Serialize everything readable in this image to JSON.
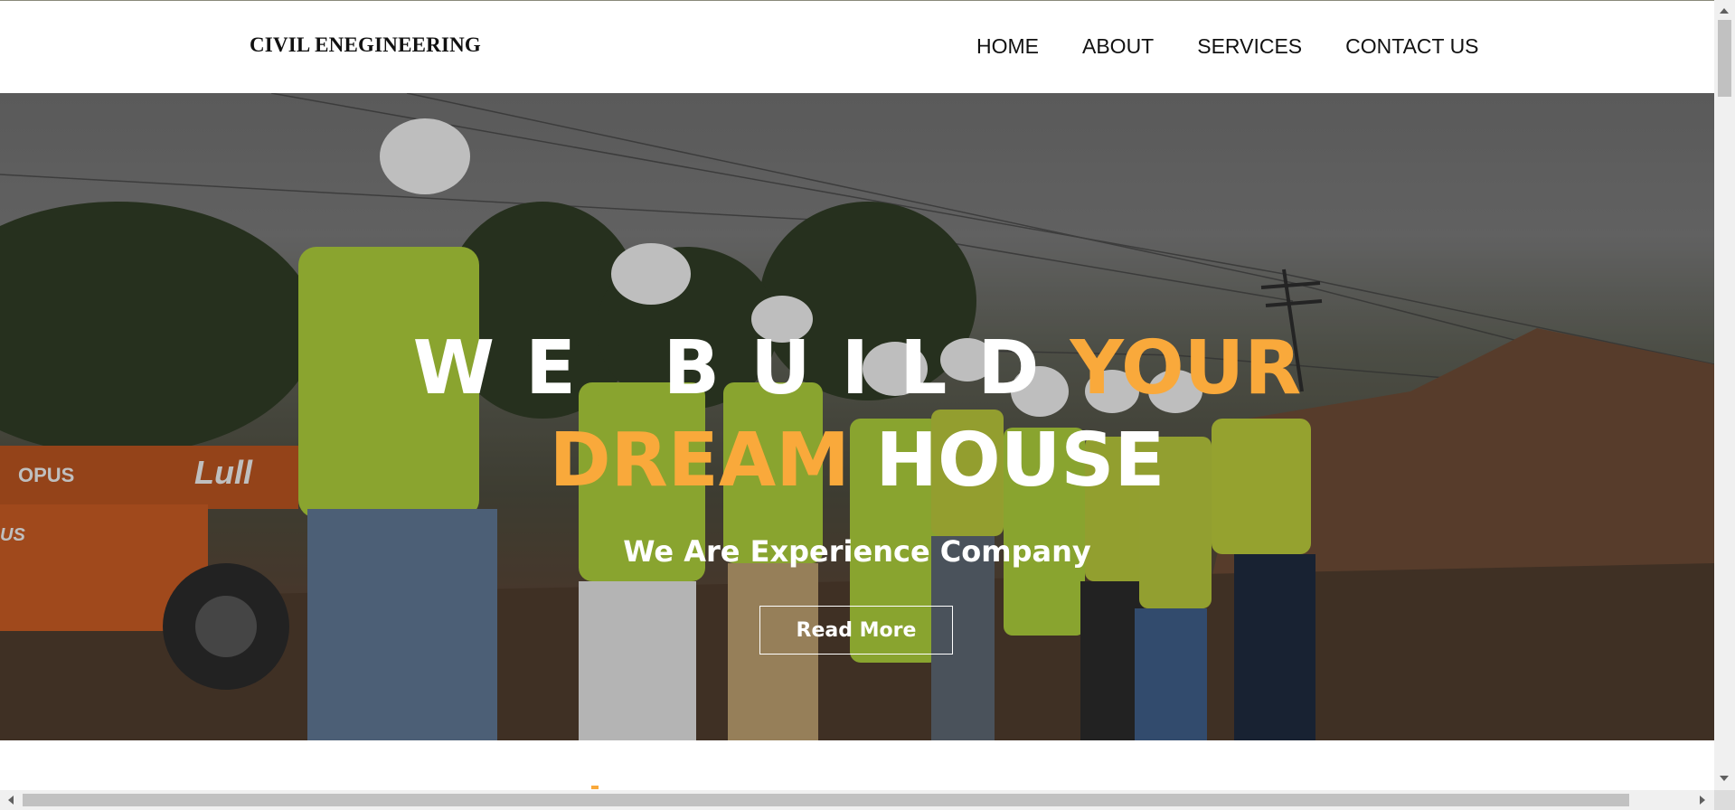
{
  "header": {
    "logo": "CIVIL ENEGINEERING",
    "nav": [
      {
        "label": "HOME"
      },
      {
        "label": "ABOUT"
      },
      {
        "label": "SERVICES"
      },
      {
        "label": "CONTACT US"
      }
    ]
  },
  "hero": {
    "line1_spaced": "WE BUILD",
    "line1_accent": "YOUR",
    "line2_accent": "DREAM",
    "line2_white": "HOUSE",
    "subtitle": "We Are Experience Company",
    "button_label": "Read More"
  },
  "scene": {
    "vehicle_brand": "OPUS",
    "vehicle_text": "Lull",
    "vehicle_fragment": "US"
  },
  "colors": {
    "accent": "#f9a93b",
    "header_bg": "#ffffff",
    "text": "#111111"
  }
}
